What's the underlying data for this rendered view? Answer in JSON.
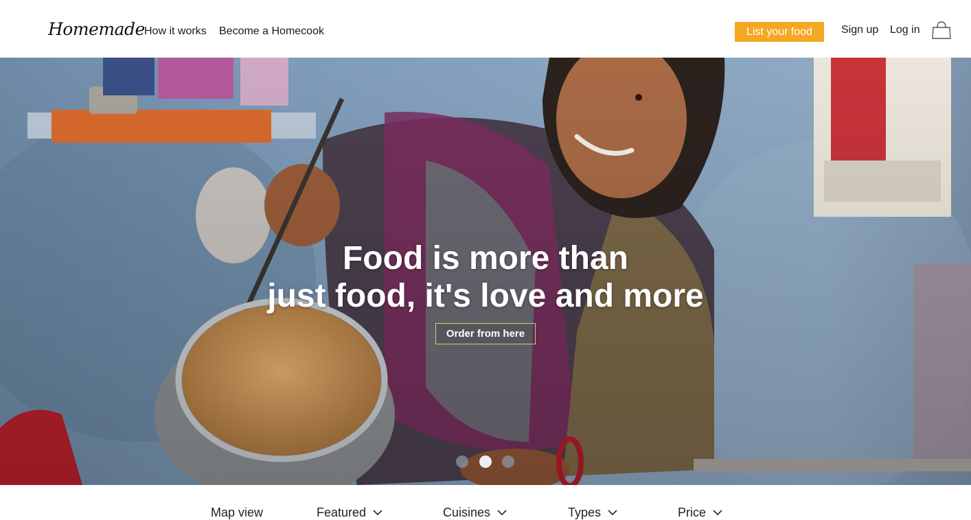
{
  "header": {
    "logo": "Homemade",
    "nav": {
      "how_it_works": "How it works",
      "become_homecook": "Become a Homecook"
    },
    "cta_label": "List your food",
    "sign_up": "Sign up",
    "log_in": "Log in",
    "cart_icon": "shopping-bag-icon"
  },
  "hero": {
    "title_line1": "Food is more than",
    "title_line2": "just food, it's love and more",
    "button_label": "Order from here",
    "carousel": {
      "slides": 3,
      "active": 2
    }
  },
  "filters": {
    "map_view": "Map view",
    "featured": "Featured",
    "cuisines": "Cuisines",
    "types": "Types",
    "price": "Price"
  },
  "colors": {
    "accent": "#f5a623",
    "hero_button_border": "#c8d66a"
  }
}
